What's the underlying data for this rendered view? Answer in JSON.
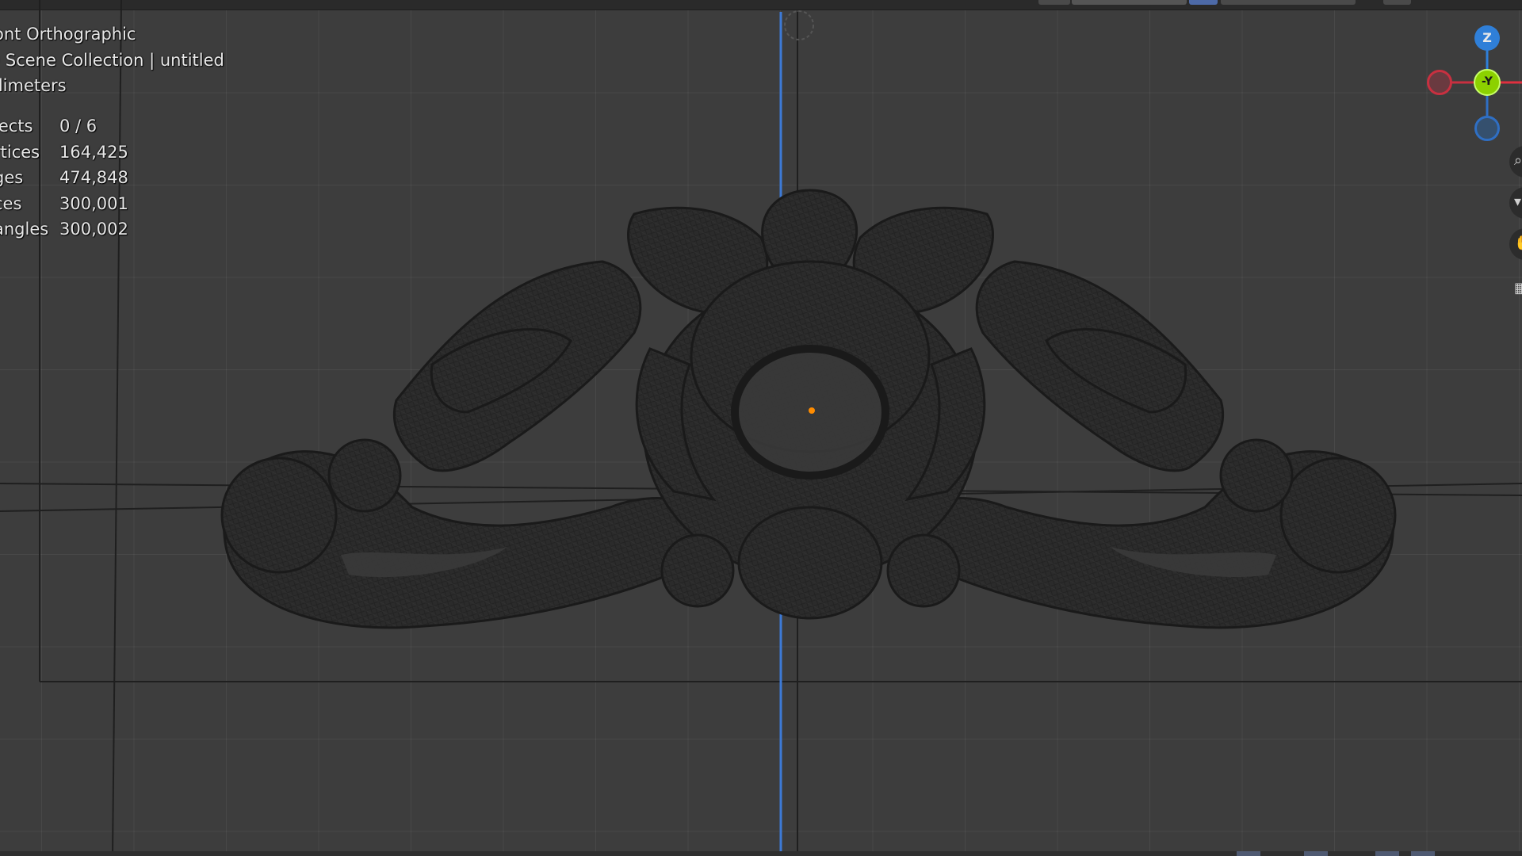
{
  "viewport": {
    "view_name": "ont Orthographic",
    "collection": ") Scene Collection | untitled",
    "units": "llimeters"
  },
  "statistics": [
    {
      "label": "jects",
      "value": "0 / 6"
    },
    {
      "label": "rtices",
      "value": "164,425"
    },
    {
      "label": "ges",
      "value": "474,848"
    },
    {
      "label": "ces",
      "value": "300,001"
    },
    {
      "label": "angles",
      "value": "300,002"
    }
  ],
  "gizmo": {
    "z_label": "Z",
    "y_label": "-Y",
    "colors": {
      "x": "#e0303f",
      "y": "#8cd100",
      "z": "#2f7fd8",
      "x_neg": "#c83040",
      "z_neg": "#2f6fc4"
    }
  },
  "colors": {
    "background": "#3d3d3d",
    "grid": "#4a4a4a",
    "z_axis_line": "#3d7ad6",
    "ornament": "#262626",
    "origin": "#ff8c00"
  },
  "side_toolbar": {
    "icons": [
      "zoom-icon",
      "dropdown-icon",
      "hand-pan-icon",
      "camera-grid-icon"
    ]
  }
}
